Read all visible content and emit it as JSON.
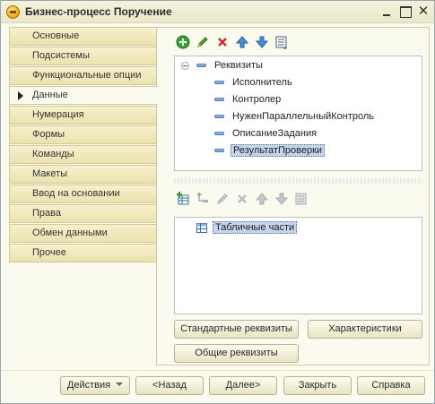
{
  "window": {
    "title": "Бизнес-процесс Поручение",
    "controls": [
      "minimize-icon",
      "maximize-icon",
      "close-icon"
    ]
  },
  "sidebar": {
    "items": [
      {
        "label": "Основные",
        "active": false
      },
      {
        "label": "Подсистемы",
        "active": false
      },
      {
        "label": "Функциональные опции",
        "active": false
      },
      {
        "label": "Данные",
        "active": true
      },
      {
        "label": "Нумерация",
        "active": false
      },
      {
        "label": "Формы",
        "active": false
      },
      {
        "label": "Команды",
        "active": false
      },
      {
        "label": "Макеты",
        "active": false
      },
      {
        "label": "Ввод на основании",
        "active": false
      },
      {
        "label": "Права",
        "active": false
      },
      {
        "label": "Обмен данными",
        "active": false
      },
      {
        "label": "Прочее",
        "active": false
      }
    ]
  },
  "attributes_toolbar": [
    "add-icon",
    "edit-icon",
    "delete-icon",
    "move-up-icon",
    "move-down-icon",
    "list-icon"
  ],
  "attributes_tree": {
    "root": "Реквизиты",
    "children": [
      {
        "label": "Исполнитель",
        "selected": false
      },
      {
        "label": "Контролер",
        "selected": false
      },
      {
        "label": "НуженПараллельныйКонтроль",
        "selected": false
      },
      {
        "label": "ОписаниеЗадания",
        "selected": false
      },
      {
        "label": "РезультатПроверки",
        "selected": true
      }
    ]
  },
  "tabular_toolbar": [
    "add-table-icon",
    "add-column-icon",
    "edit-icon",
    "delete-icon",
    "move-up-icon",
    "move-down-icon",
    "list-icon"
  ],
  "tabular_tree": {
    "root": "Табличные части",
    "selected": true
  },
  "panel_buttons": {
    "standard": "Стандартные реквизиты",
    "characteristics": "Характеристики",
    "common": "Общие реквизиты"
  },
  "footer": {
    "actions": "Действия",
    "back": "<Назад",
    "next": "Далее>",
    "close": "Закрыть",
    "help": "Справка"
  },
  "colors": {
    "background": "#fbfaef",
    "tab_bg": "#f1eac0",
    "selection": "#c5d5ee"
  }
}
